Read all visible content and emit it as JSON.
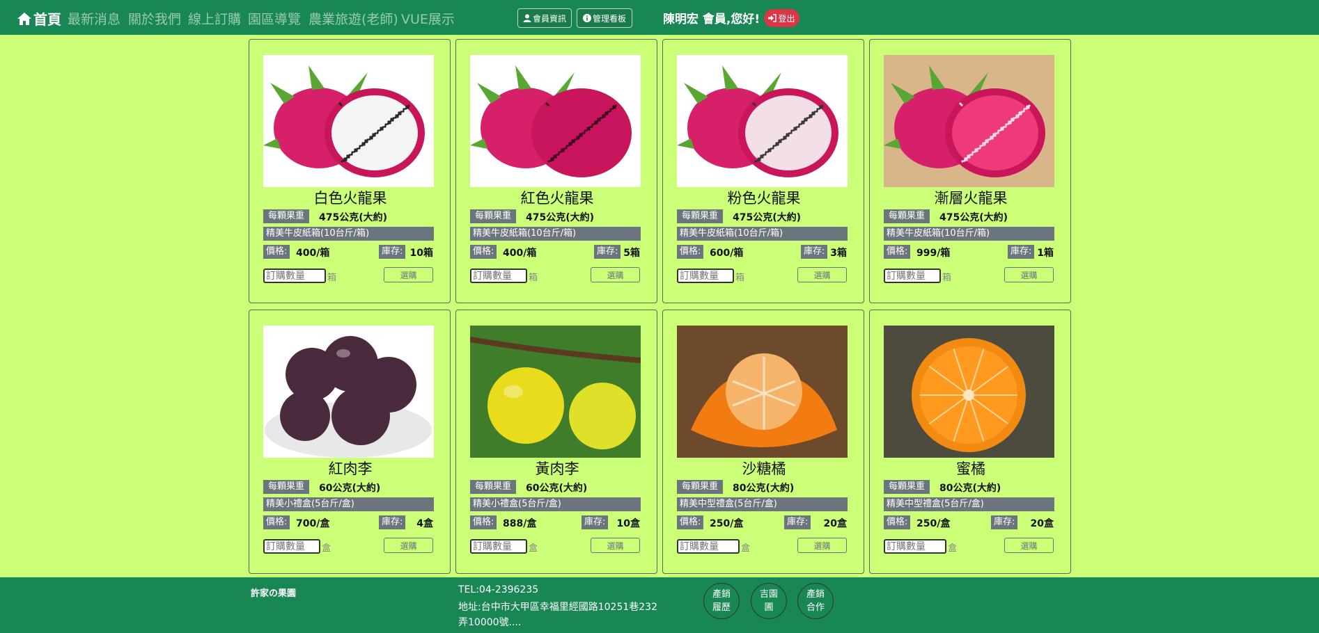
{
  "nav": {
    "home": "首頁",
    "links": [
      "最新消息",
      "關於我們",
      "線上訂購",
      "園區導覽",
      "農業旅遊(老師)",
      "VUE展示"
    ],
    "member_btn": "會員資訊",
    "admin_btn": "管理看板",
    "greeting": "陳明宏 會員,您好!",
    "logout": "登出"
  },
  "labels": {
    "weight": "每顆果重",
    "price": "價格:",
    "stock": "庫存:",
    "qty_placeholder": "訂購數量",
    "buy": "選購"
  },
  "products": [
    {
      "name": "白色火龍果",
      "weight": "475公克(大約)",
      "box": "精美牛皮紙箱(10台斤/箱)",
      "price": "400/箱",
      "stock": "10箱",
      "unit": "箱"
    },
    {
      "name": "紅色火龍果",
      "weight": "475公克(大約)",
      "box": "精美牛皮紙箱(10台斤/箱)",
      "price": "400/箱",
      "stock": "5箱",
      "unit": "箱"
    },
    {
      "name": "粉色火龍果",
      "weight": "475公克(大約)",
      "box": "精美牛皮紙箱(10台斤/箱)",
      "price": "600/箱",
      "stock": "3箱",
      "unit": "箱"
    },
    {
      "name": "漸層火龍果",
      "weight": "475公克(大約)",
      "box": "精美牛皮紙箱(10台斤/箱)",
      "price": "999/箱",
      "stock": "1箱",
      "unit": "箱"
    },
    {
      "name": "紅肉李",
      "weight": "60公克(大約)",
      "box": "精美小禮盒(5台斤/盒)",
      "price": "700/盒",
      "stock": "4盒",
      "unit": "盒"
    },
    {
      "name": "黃肉李",
      "weight": "60公克(大約)",
      "box": "精美小禮盒(5台斤/盒)",
      "price": "888/盒",
      "stock": "10盒",
      "unit": "盒"
    },
    {
      "name": "沙糖橘",
      "weight": "80公克(大約)",
      "box": "精美中型禮盒(5台斤/盒)",
      "price": "250/盒",
      "stock": "20盒",
      "unit": "盒"
    },
    {
      "name": "蜜橘",
      "weight": "80公克(大約)",
      "box": "精美中型禮盒(5台斤/盒)",
      "price": "250/盒",
      "stock": "20盒",
      "unit": "盒"
    }
  ],
  "footer": {
    "brand": "許家の果園",
    "tel": "TEL:04-2396235",
    "address": "地址:台中市大甲區幸福里經國路10251巷232弄10000號....",
    "circles": [
      {
        "line1": "產銷",
        "line2": "履歷"
      },
      {
        "line1": "吉園",
        "line2": "圃"
      },
      {
        "line1": "產銷",
        "line2": "合作"
      }
    ]
  },
  "colors": {
    "background": "#ccff78",
    "navbar": "#198754",
    "tag": "#6c757d",
    "logout": "#dc3545"
  }
}
